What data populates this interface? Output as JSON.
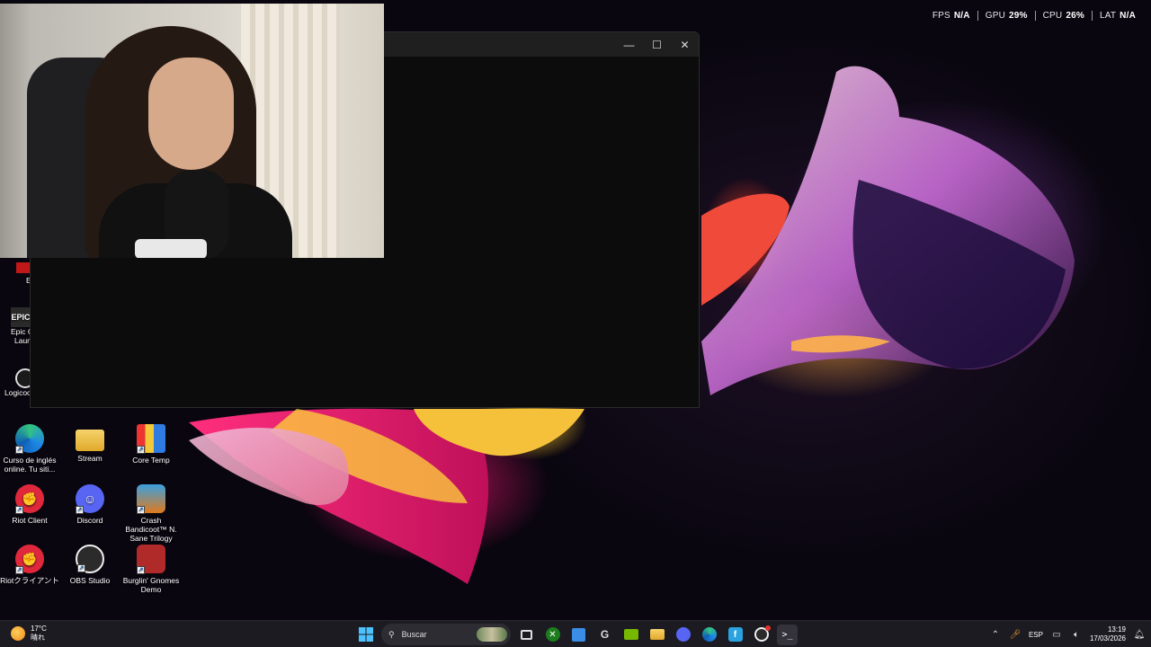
{
  "overlay": {
    "fps_label": "FPS",
    "fps_value": "N/A",
    "gpu_label": "GPU",
    "gpu_value": "29%",
    "cpu_label": "CPU",
    "cpu_value": "26%",
    "lat_label": "LAT",
    "lat_value": "N/A"
  },
  "terminal": {
    "minimize_glyph": "—",
    "maximize_glyph": "☐",
    "close_glyph": "✕"
  },
  "desktop": {
    "partial_labels": [
      "E",
      "Epic G",
      "Laun",
      "Logicoo"
    ],
    "icons": [
      {
        "label": "Curso de inglés online. Tu siti...",
        "icon": "edge-icon"
      },
      {
        "label": "Stream",
        "icon": "folder-icon"
      },
      {
        "label": "Core Temp",
        "icon": "core-temp-icon"
      },
      {
        "label": "Riot Client",
        "icon": "riot-icon"
      },
      {
        "label": "Discord",
        "icon": "discord-icon"
      },
      {
        "label": "Crash Bandicoot™ N. Sane Trilogy",
        "icon": "crash-icon"
      },
      {
        "label": "Riotクライアント",
        "icon": "riot-icon"
      },
      {
        "label": "OBS Studio",
        "icon": "obs-icon"
      },
      {
        "label": "Burglin' Gnomes Demo",
        "icon": "gnomes-icon"
      }
    ]
  },
  "taskbar": {
    "weather_temp": "17°C",
    "weather_desc": "晴れ",
    "search_placeholder": "Buscar",
    "language": "ESP",
    "time": "13:19",
    "date": "17/03/2026"
  },
  "colors": {
    "taskbar_bg": "#1c1b22",
    "terminal_bg": "#0c0c0c",
    "titlebar_bg": "#1f1f1f"
  }
}
